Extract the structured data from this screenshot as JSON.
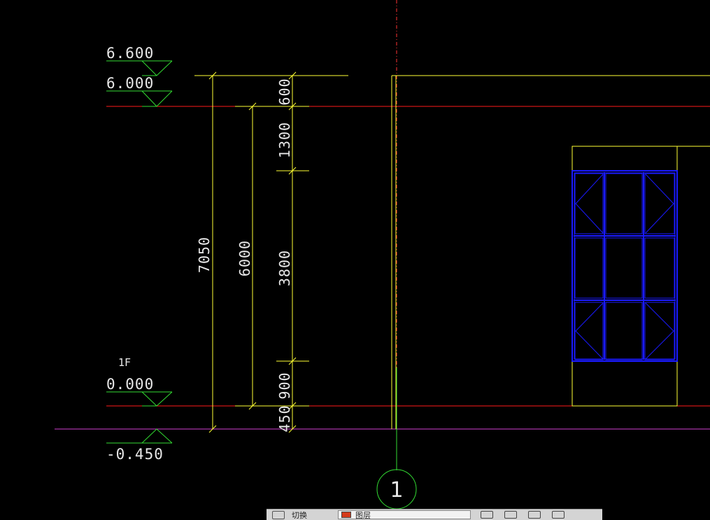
{
  "colors": {
    "background": "#000000",
    "level_line": "#ff1a1a",
    "ground_line": "#d040d0",
    "dimension": "#ffff33",
    "symbol": "#33dd33",
    "window_frame": "#1a1aff",
    "axis_line_dashed": "#ff3333",
    "text": "#e8e8e8"
  },
  "levels": {
    "roof_top": "6.600",
    "roof": "6.000",
    "floor_name": "1F",
    "ground_floor": "0.000",
    "outdoor_ground": "-0.450"
  },
  "dimensions": {
    "total": "7050",
    "floor_to_roof": "6000",
    "parapet": "600",
    "above_window": "1300",
    "window": "3800",
    "sill": "900",
    "plinth": "450"
  },
  "axis": {
    "label": "1"
  },
  "statusbar": {
    "field1": "切换",
    "layer": "图层"
  }
}
